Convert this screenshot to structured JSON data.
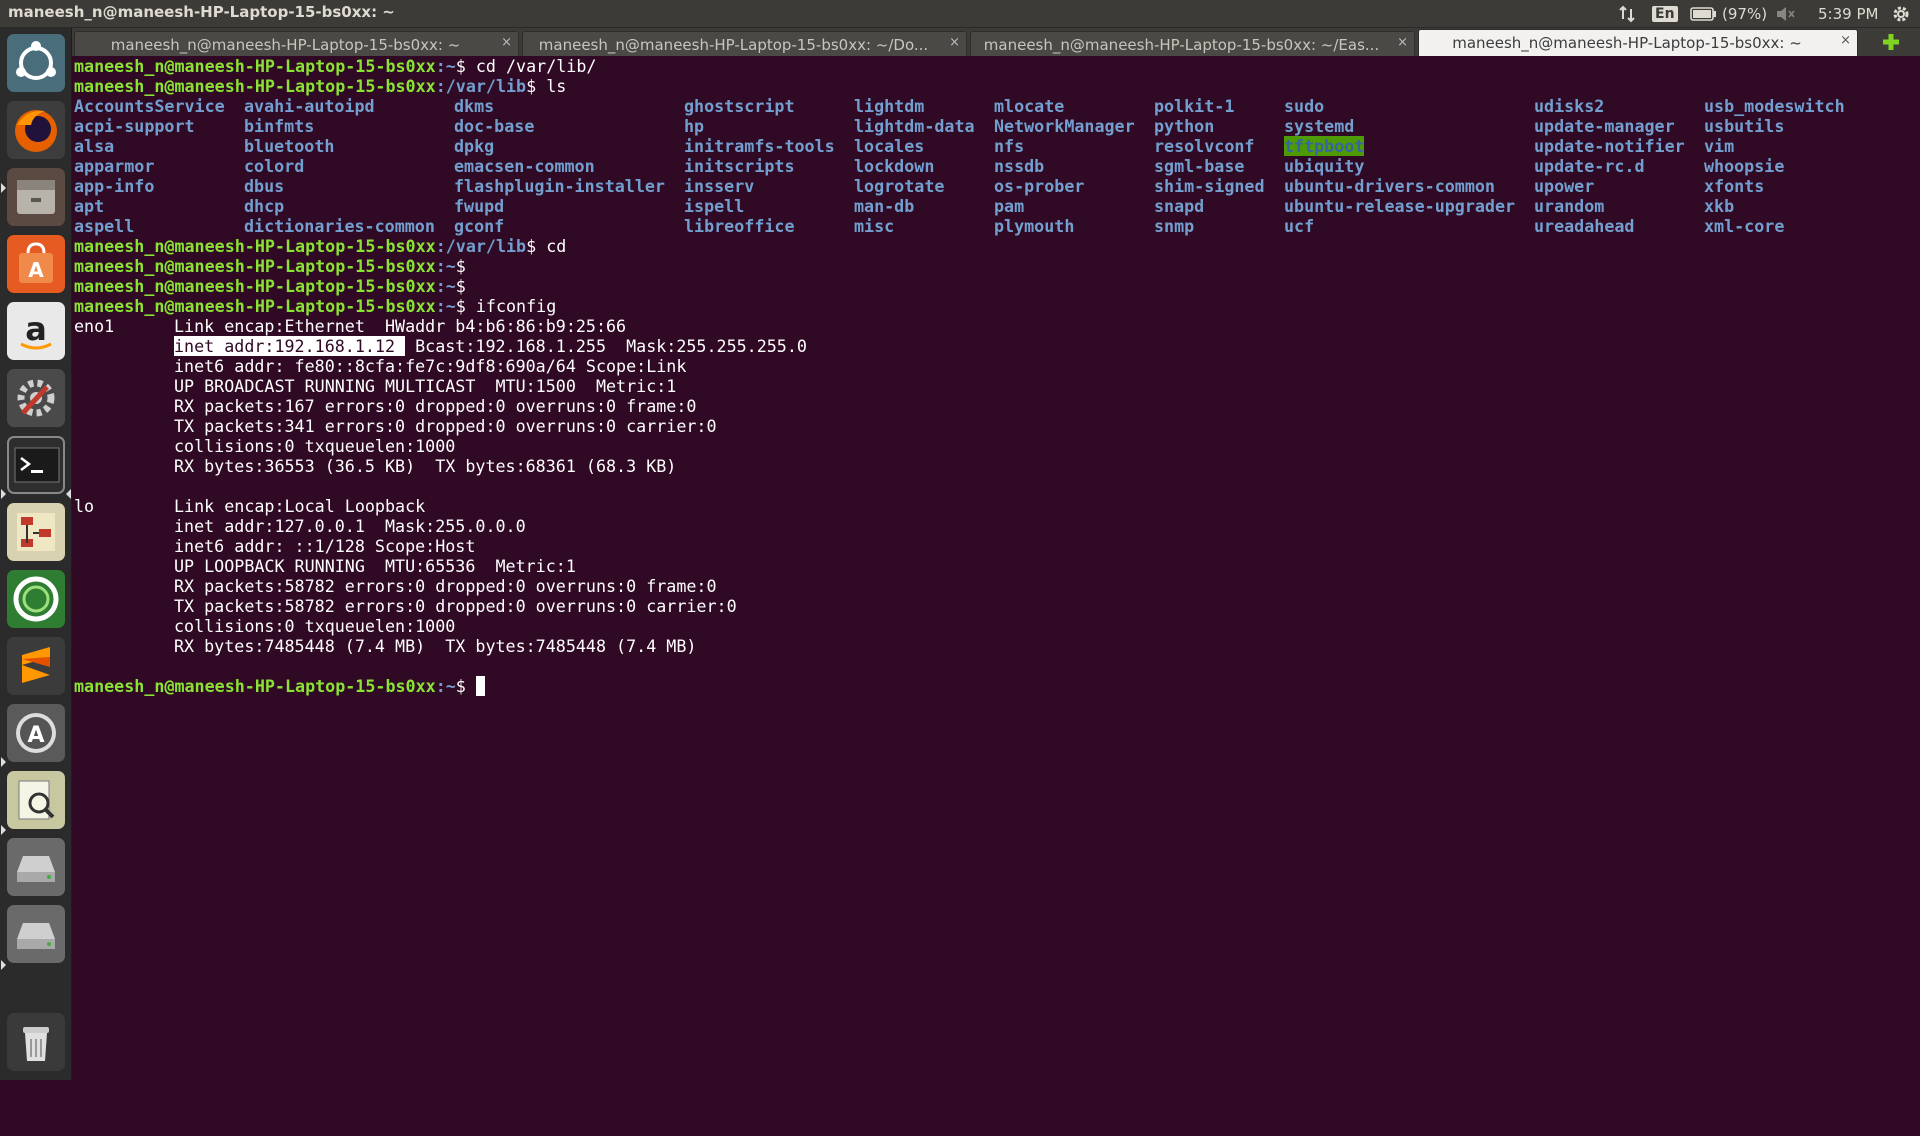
{
  "window_title": "maneesh_n@maneesh-HP-Laptop-15-bs0xx: ~",
  "tray": {
    "keyboard_layout": "En",
    "battery": "(97%)",
    "time": "5:39 PM"
  },
  "launcher_icons": [
    "ubuntu-dash-icon",
    "firefox-icon",
    "files-icon",
    "software-center-icon",
    "amazon-icon",
    "system-settings-icon",
    "terminal-icon",
    "diagram-editor-icon",
    "qbittorrent-icon",
    "sublime-text-icon",
    "software-updater-icon",
    "document-viewer-icon",
    "drive-icon",
    "drive-icon-2",
    "trash-icon"
  ],
  "tabs": [
    {
      "label": "maneesh_n@maneesh-HP-Laptop-15-bs0xx: ~",
      "active": false
    },
    {
      "label": "maneesh_n@maneesh-HP-Laptop-15-bs0xx: ~/Do...",
      "active": false
    },
    {
      "label": "maneesh_n@maneesh-HP-Laptop-15-bs0xx: ~/Eas...",
      "active": false
    },
    {
      "label": "maneesh_n@maneesh-HP-Laptop-15-bs0xx: ~",
      "active": true
    }
  ],
  "tab_close": "×",
  "terminal": {
    "prompt_user": "maneesh_n@maneesh-HP-Laptop-15-bs0xx",
    "lines": [
      {
        "path": ":~",
        "cmd": "$ cd /var/lib/"
      },
      {
        "path": ":/var/lib",
        "cmd": "$ ls"
      }
    ],
    "ls_columns": [
      [
        "AccountsService",
        "acpi-support",
        "alsa",
        "apparmor",
        "app-info",
        "apt",
        "aspell"
      ],
      [
        "avahi-autoipd",
        "binfmts",
        "bluetooth",
        "colord",
        "dbus",
        "dhcp",
        "dictionaries-common"
      ],
      [
        "dkms",
        "doc-base",
        "dpkg",
        "emacsen-common",
        "flashplugin-installer",
        "fwupd",
        "gconf"
      ],
      [
        "ghostscript",
        "hp",
        "initramfs-tools",
        "initscripts",
        "insserv",
        "ispell",
        "libreoffice"
      ],
      [
        "lightdm",
        "lightdm-data",
        "locales",
        "lockdown",
        "logrotate",
        "man-db",
        "misc"
      ],
      [
        "mlocate",
        "NetworkManager",
        "nfs",
        "nssdb",
        "os-prober",
        "pam",
        "plymouth"
      ],
      [
        "polkit-1",
        "python",
        "resolvconf",
        "sgml-base",
        "shim-signed",
        "snapd",
        "snmp"
      ],
      [
        "sudo",
        "systemd",
        "tftpboot",
        "ubiquity",
        "ubuntu-drivers-common",
        "ubuntu-release-upgrader",
        "ucf"
      ],
      [
        "udisks2",
        "update-manager",
        "update-notifier",
        "update-rc.d",
        "upower",
        "urandom",
        "ureadahead"
      ],
      [
        "usb_modeswitch",
        "usbutils",
        "vim",
        "whoopsie",
        "xfonts",
        "xkb",
        "xml-core"
      ]
    ],
    "after_ls": [
      {
        "path": ":/var/lib",
        "cmd": "$ cd"
      },
      {
        "path": ":~",
        "cmd": "$"
      },
      {
        "path": ":~",
        "cmd": "$"
      },
      {
        "path": ":~",
        "cmd": "$ ifconfig"
      }
    ],
    "ifconfig_eno1": {
      "iface": "eno1",
      "line1": "Link encap:Ethernet  HWaddr b4:b6:86:b9:25:66",
      "inet_selected": "inet addr:192.168.1.12 ",
      "inet_rest": " Bcast:192.168.1.255  Mask:255.255.255.0",
      "lines": [
        "inet6 addr: fe80::8cfa:fe7c:9df8:690a/64 Scope:Link",
        "UP BROADCAST RUNNING MULTICAST  MTU:1500  Metric:1",
        "RX packets:167 errors:0 dropped:0 overruns:0 frame:0",
        "TX packets:341 errors:0 dropped:0 overruns:0 carrier:0",
        "collisions:0 txqueuelen:1000",
        "RX bytes:36553 (36.5 KB)  TX bytes:68361 (68.3 KB)"
      ]
    },
    "ifconfig_lo": {
      "iface": "lo",
      "line1": "Link encap:Local Loopback",
      "lines": [
        "inet addr:127.0.0.1  Mask:255.0.0.0",
        "inet6 addr: ::1/128 Scope:Host",
        "UP LOOPBACK RUNNING  MTU:65536  Metric:1",
        "RX packets:58782 errors:0 dropped:0 overruns:0 frame:0",
        "TX packets:58782 errors:0 dropped:0 overruns:0 carrier:0",
        "collisions:0 txqueuelen:1000",
        "RX bytes:7485448 (7.4 MB)  TX bytes:7485448 (7.4 MB)"
      ]
    },
    "final_prompt": {
      "path": ":~",
      "cmd": "$ "
    }
  },
  "colors": {
    "terminal_bg": "#300a24",
    "prompt_green": "#8ae234",
    "dir_blue": "#729fcf",
    "panel": "#3c3b37"
  }
}
